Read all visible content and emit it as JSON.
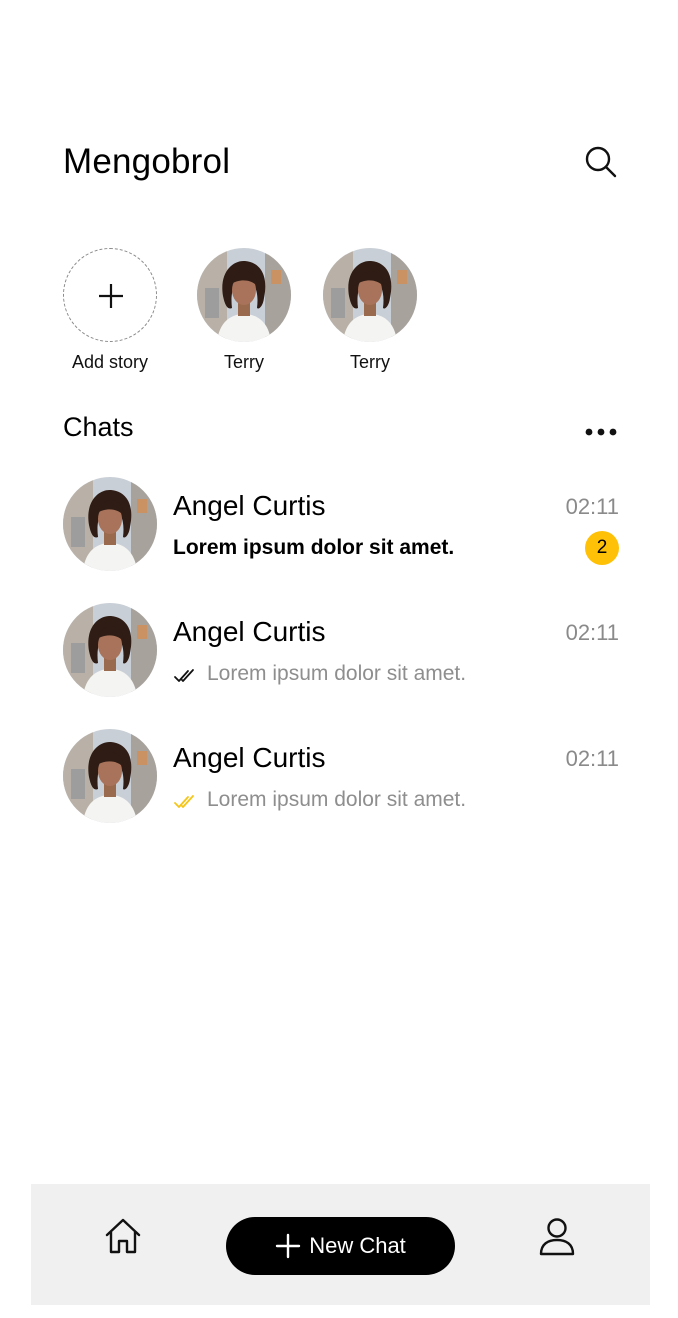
{
  "header": {
    "title": "Mengobrol",
    "search_icon": "search-icon"
  },
  "stories": {
    "add_label": "Add story",
    "items": [
      {
        "name": "Terry"
      },
      {
        "name": "Terry"
      }
    ]
  },
  "chats": {
    "section_title": "Chats",
    "more_icon": "more-horizontal-icon",
    "items": [
      {
        "name": "Angel Curtis",
        "time": "02:11",
        "preview": "Lorem ipsum dolor sit amet.",
        "unread_count": "2",
        "status": "unread"
      },
      {
        "name": "Angel Curtis",
        "time": "02:11",
        "preview": "Lorem ipsum dolor sit amet.",
        "status": "delivered"
      },
      {
        "name": "Angel Curtis",
        "time": "02:11",
        "preview": "Lorem ipsum dolor sit amet.",
        "status": "read"
      }
    ]
  },
  "bottom_nav": {
    "home_icon": "home-icon",
    "new_chat_label": "New Chat",
    "profile_icon": "profile-icon"
  },
  "colors": {
    "accent": "#FFC107",
    "read_tick": "#F5C518",
    "delivered_tick": "#111111",
    "muted_text": "#8E8E8E",
    "bottom_bar_bg": "#F0F0F0",
    "primary_button": "#000000"
  }
}
